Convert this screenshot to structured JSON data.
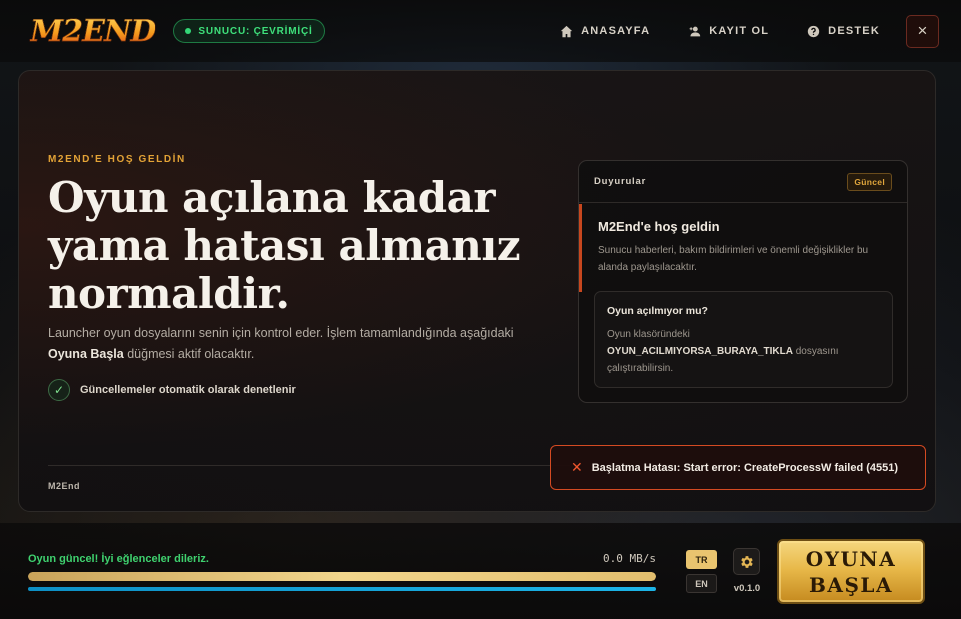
{
  "header": {
    "logo": "M2END",
    "status": "SUNUCU: ÇEVRİMİÇİ",
    "nav": [
      {
        "label": "ANASAYFA",
        "icon": "home-icon"
      },
      {
        "label": "KAYIT OL",
        "icon": "add-user-icon"
      },
      {
        "label": "DESTEK",
        "icon": "help-icon"
      }
    ],
    "close": "×"
  },
  "hero": {
    "eyebrow": "M2END'E HOŞ GELDİN",
    "headline": "Oyun açılana kadar yama hatası almanız normaldir.",
    "desc_prefix": "Launcher oyun dosyalarını senin için kontrol eder. İşlem tamamlandığında aşağıdaki ",
    "desc_bold": "Oyuna Başla",
    "desc_suffix": " düğmesi aktif olacaktır.",
    "check_label": "Güncellemeler otomatik olarak denetlenir",
    "footer_brand": "M2End"
  },
  "announcements": {
    "title": "Duyurular",
    "badge": "Güncel",
    "item1": {
      "title": "M2End'e hoş geldin",
      "body": "Sunucu haberleri, bakım bildirimleri ve önemli değişiklikler bu alanda paylaşılacaktır."
    },
    "item2": {
      "title": "Oyun açılmıyor mu?",
      "body_prefix": "Oyun klasöründeki",
      "body_bold": "OYUN_ACILMIYORSA_BURAYA_TIKLA",
      "body_suffix": " dosyasını çalıştırabilirsin."
    }
  },
  "toast": {
    "message": "Başlatma Hatası: Start error: CreateProcessW failed (4551)"
  },
  "bottom": {
    "progress_label": "Oyun güncel! İyi eğlenceler dileriz.",
    "speed": "0.0 MB/s",
    "progress_percent": 100,
    "secondary_percent": 100,
    "lang_tr": "TR",
    "lang_en": "EN",
    "version": "v0.1.0",
    "play_line1": "OYUNA",
    "play_line2": "BAŞLA"
  },
  "colors": {
    "accent_gold": "#e3a336",
    "online_green": "#3ee07b",
    "error_red": "#d44a22"
  }
}
